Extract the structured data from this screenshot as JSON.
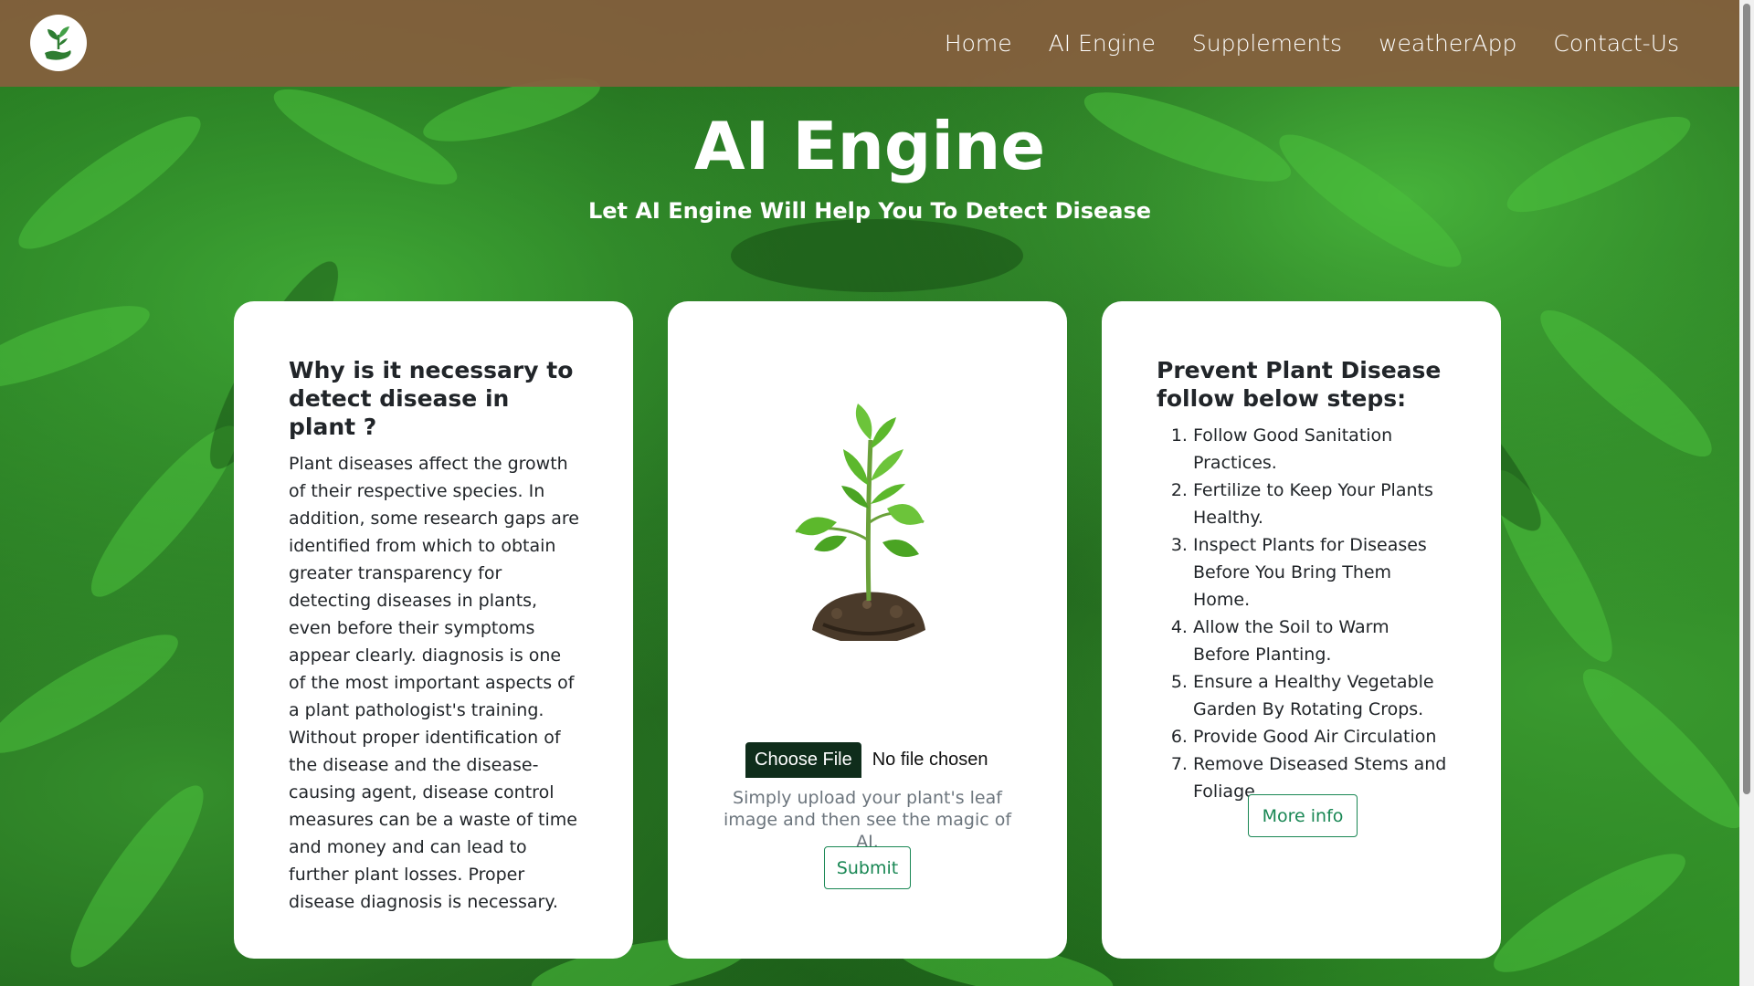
{
  "nav": {
    "logo": "leaf-hand-logo",
    "links": [
      "Home",
      "AI Engine",
      "Supplements",
      "weatherApp",
      "Contact-Us"
    ]
  },
  "hero": {
    "title": "AI Engine",
    "subtitle": "Let AI Engine Will Help You To Detect Disease"
  },
  "why_card": {
    "title": "Why is it necessary to detect disease in plant ?",
    "body": "Plant diseases affect the growth of their respective species. In addition, some research gaps are identified from which to obtain greater transparency for detecting diseases in plants, even before their symptoms appear clearly. diagnosis is one of the most important aspects of a plant pathologist's training. Without proper identification of the disease and the disease-causing agent, disease control measures can be a waste of time and money and can lead to further plant losses. Proper disease diagnosis is necessary."
  },
  "upload_card": {
    "image": "seedling-in-soil",
    "choose_file_label": "Choose File",
    "no_file_text": "No file chosen",
    "hint": "Simply upload your plant's leaf image and then see the magic of AI.",
    "submit_label": "Submit"
  },
  "prevent_card": {
    "title": "Prevent Plant Disease follow below steps:",
    "steps": [
      "Follow Good Sanitation Practices.",
      "Fertilize to Keep Your Plants Healthy.",
      "Inspect Plants for Diseases Before You Bring Them Home.",
      "Allow the Soil to Warm Before Planting.",
      "Ensure a Healthy Vegetable Garden By Rotating Crops.",
      "Provide Good Air Circulation",
      "Remove Diseased Stems and Foliage"
    ],
    "more_label": "More info"
  },
  "colors": {
    "navbar": "#875e3e",
    "accent_green": "#198754",
    "choose_btn": "#0f2d1b"
  }
}
